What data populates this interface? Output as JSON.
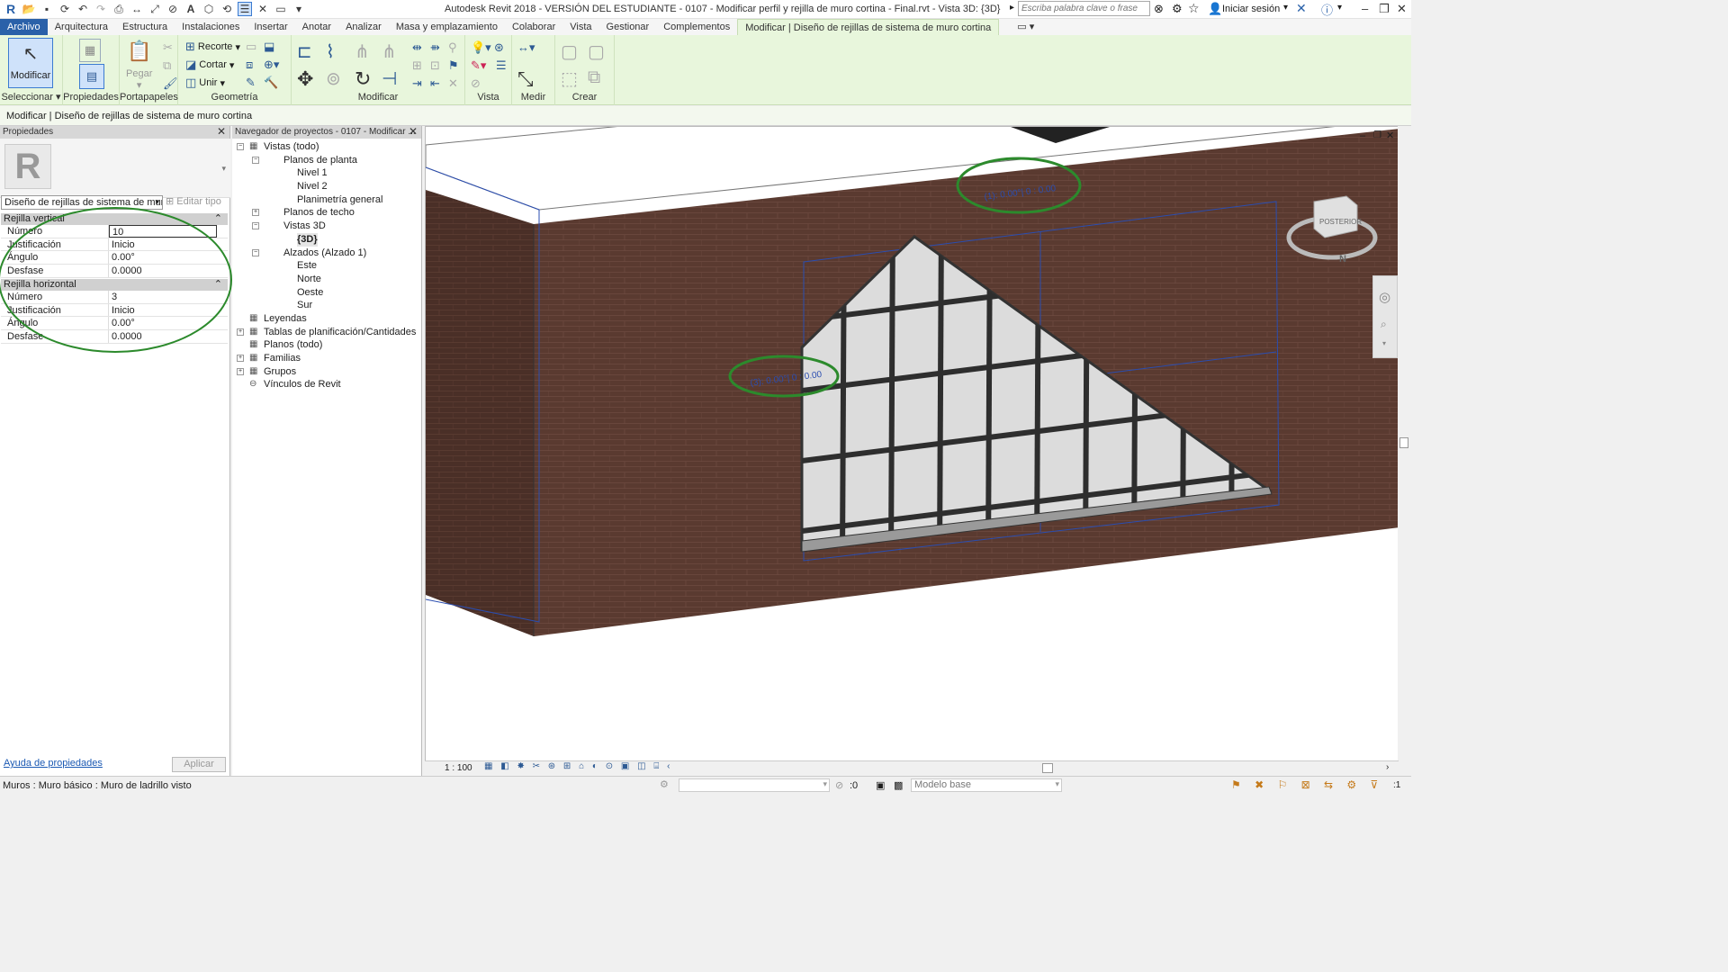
{
  "titlebar": {
    "title": "Autodesk Revit 2018 - VERSIÓN DEL ESTUDIANTE -     0107 - Modificar perfil y rejilla de muro cortina - Final.rvt - Vista 3D: {3D}",
    "search_placeholder": "Escriba palabra clave o frase",
    "signin_label": "Iniciar sesión"
  },
  "tabs": [
    {
      "label": "Archivo"
    },
    {
      "label": "Arquitectura"
    },
    {
      "label": "Estructura"
    },
    {
      "label": "Instalaciones"
    },
    {
      "label": "Insertar"
    },
    {
      "label": "Anotar"
    },
    {
      "label": "Analizar"
    },
    {
      "label": "Masa y emplazamiento"
    },
    {
      "label": "Colaborar"
    },
    {
      "label": "Vista"
    },
    {
      "label": "Gestionar"
    },
    {
      "label": "Complementos"
    },
    {
      "label": "Modificar | Diseño de rejillas de sistema de muro cortina"
    }
  ],
  "ribbon": {
    "modify_label": "Modificar",
    "select_label": "Seleccionar",
    "properties_label": "Propiedades",
    "paste_label": "Pegar",
    "clipboard_label": "Portapapeles",
    "cope_label": "Recorte",
    "cut_label": "Cortar",
    "join_label": "Unir",
    "geometry_label": "Geometría",
    "modify_panel_label": "Modificar",
    "view_label": "Vista",
    "measure_label": "Medir",
    "create_label": "Crear"
  },
  "context_bar": "Modificar | Diseño de rejillas de sistema de muro cortina",
  "properties": {
    "header": "Propiedades",
    "type_name": "Diseño de rejillas de sistema de muro",
    "edit_type_label": "Editar tipo",
    "groups": [
      {
        "name": "Rejilla vertical",
        "rows": [
          {
            "key": "Número",
            "value": "10"
          },
          {
            "key": "Justificación",
            "value": "Inicio"
          },
          {
            "key": "Ángulo",
            "value": "0.00°"
          },
          {
            "key": "Desfase",
            "value": "0.0000"
          }
        ]
      },
      {
        "name": "Rejilla horizontal",
        "rows": [
          {
            "key": "Número",
            "value": "3"
          },
          {
            "key": "Justificación",
            "value": "Inicio"
          },
          {
            "key": "Ángulo",
            "value": "0.00°"
          },
          {
            "key": "Desfase",
            "value": "0.0000"
          }
        ]
      }
    ],
    "help_link": "Ayuda de propiedades",
    "apply_label": "Aplicar"
  },
  "browser": {
    "header": "Navegador de proyectos - 0107 - Modificar ...",
    "nodes": [
      {
        "label": "Vistas (todo)",
        "level": 0,
        "exp": "−"
      },
      {
        "label": "Planos de planta",
        "level": 1,
        "exp": "−"
      },
      {
        "label": "Nivel 1",
        "level": 2,
        "exp": ""
      },
      {
        "label": "Nivel 2",
        "level": 2,
        "exp": ""
      },
      {
        "label": "Planimetría general",
        "level": 2,
        "exp": ""
      },
      {
        "label": "Planos de techo",
        "level": 1,
        "exp": "+"
      },
      {
        "label": "Vistas 3D",
        "level": 1,
        "exp": "−"
      },
      {
        "label": "{3D}",
        "level": 2,
        "exp": "",
        "bold": true
      },
      {
        "label": "Alzados (Alzado 1)",
        "level": 1,
        "exp": "−"
      },
      {
        "label": "Este",
        "level": 2,
        "exp": ""
      },
      {
        "label": "Norte",
        "level": 2,
        "exp": ""
      },
      {
        "label": "Oeste",
        "level": 2,
        "exp": ""
      },
      {
        "label": "Sur",
        "level": 2,
        "exp": ""
      },
      {
        "label": "Leyendas",
        "level": 0,
        "exp": ""
      },
      {
        "label": "Tablas de planificación/Cantidades",
        "level": 0,
        "exp": "+"
      },
      {
        "label": "Planos (todo)",
        "level": 0,
        "exp": ""
      },
      {
        "label": "Familias",
        "level": 0,
        "exp": "+"
      },
      {
        "label": "Grupos",
        "level": 0,
        "exp": "+"
      },
      {
        "label": "Vínculos de Revit",
        "level": 0,
        "exp": ""
      }
    ]
  },
  "viewport": {
    "scale": "1 : 100",
    "viewcube_face": "POSTERIOR",
    "compass_letter": "N",
    "annotation_top": "(1): 0.00°| 0 : 0.00",
    "annotation_left": "(3): 0.00°| 0 : 0.00"
  },
  "statusbar": {
    "message": "Muros : Muro básico : Muro de ladrillo visto",
    "zero": ":0",
    "model": "Modelo base"
  },
  "colors": {
    "brick": "#5a3a30",
    "ribbon_bg": "#e8f6dc",
    "highlight_ellipse": "#2c8a2c",
    "file_tab": "#2a61a9"
  }
}
